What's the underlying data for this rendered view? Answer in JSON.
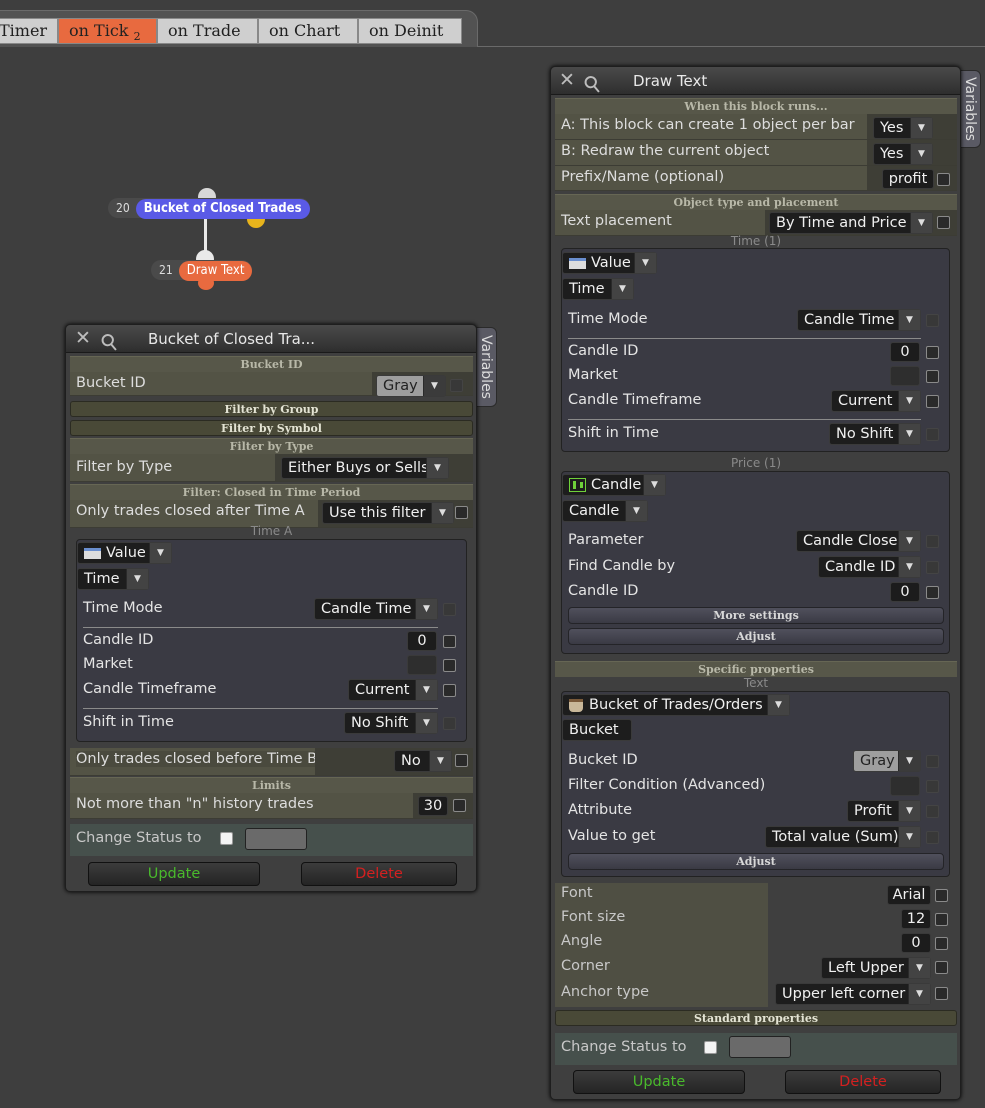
{
  "tabs": [
    {
      "label": "Timer",
      "active": false
    },
    {
      "label": "on Tick",
      "badge": "2",
      "active": true
    },
    {
      "label": "on Trade",
      "active": false
    },
    {
      "label": "on Chart",
      "active": false
    },
    {
      "label": "on Deinit",
      "active": false
    }
  ],
  "nodes": {
    "bucket": {
      "id": "20",
      "label": "Bucket of Closed Trades",
      "color": "#5a5ae6"
    },
    "draw": {
      "id": "21",
      "label": "Draw Text",
      "color": "#e86a3f"
    }
  },
  "left_panel": {
    "title": "Bucket of Closed Tra...",
    "variables_tab": "Variables",
    "bucket_section": "Bucket ID",
    "bucket_label": "Bucket ID",
    "bucket_value": "Gray",
    "filter_group": "Filter by Group",
    "filter_symbol": "Filter by Symbol",
    "filter_type_section": "Filter by Type",
    "filter_type_label": "Filter by Type",
    "filter_type_value": "Either Buys or Sells",
    "closed_section": "Filter: Closed in Time Period",
    "after_label": "Only trades closed after Time A",
    "after_value": "Use this filter",
    "time_a_caption": "Time A",
    "value_label": "Value",
    "time_label": "Time",
    "time_mode_label": "Time Mode",
    "time_mode_value": "Candle Time",
    "candle_id_label": "Candle ID",
    "candle_id_value": "0",
    "market_label": "Market",
    "timeframe_label": "Candle Timeframe",
    "timeframe_value": "Current",
    "shift_label": "Shift in Time",
    "shift_value": "No Shift",
    "before_label": "Only trades closed before Time B",
    "before_value": "No",
    "limits_section": "Limits",
    "limit_label": "Not more than \"n\" history trades",
    "limit_value": "30",
    "status_label": "Change Status to",
    "update": "Update",
    "delete": "Delete"
  },
  "right_panel": {
    "title": "Draw Text",
    "variables_tab": "Variables",
    "runs_section": "When this block runs...",
    "a_label": "A: This block can create 1 object per bar",
    "a_value": "Yes",
    "b_label": "B: Redraw the current object",
    "b_value": "Yes",
    "prefix_label": "Prefix/Name (optional)",
    "prefix_value": "profit",
    "obj_section": "Object type and placement",
    "placement_label": "Text placement",
    "placement_value": "By Time and Price",
    "time1_caption": "Time (1)",
    "value_label": "Value",
    "time_label": "Time",
    "time_mode_label": "Time Mode",
    "time_mode_value": "Candle Time",
    "candle_id_label": "Candle ID",
    "candle_id_value": "0",
    "market_label": "Market",
    "timeframe_label": "Candle Timeframe",
    "timeframe_value": "Current",
    "shift_label": "Shift in Time",
    "shift_value": "No Shift",
    "price1_caption": "Price (1)",
    "candle_label": "Candle",
    "candle_sub": "Candle",
    "parameter_label": "Parameter",
    "parameter_value": "Candle Close",
    "find_label": "Find Candle by",
    "find_value": "Candle ID",
    "candle_id2_label": "Candle ID",
    "candle_id2_value": "0",
    "more_settings": "More settings",
    "adjust": "Adjust",
    "specific_section": "Specific properties",
    "text_caption": "Text",
    "bucket_source": "Bucket of Trades/Orders",
    "bucket_sub": "Bucket",
    "bucket_id_label": "Bucket ID",
    "bucket_id_value": "Gray",
    "filter_cond_label": "Filter Condition (Advanced)",
    "attribute_label": "Attribute",
    "attribute_value": "Profit",
    "value_get_label": "Value to get",
    "value_get_value": "Total value (Sum)",
    "adjust2": "Adjust",
    "font_label": "Font",
    "font_value": "Arial",
    "fontsize_label": "Font size",
    "fontsize_value": "12",
    "angle_label": "Angle",
    "angle_value": "0",
    "corner_label": "Corner",
    "corner_value": "Left Upper",
    "anchor_label": "Anchor type",
    "anchor_value": "Upper left corner",
    "standard_section": "Standard properties",
    "status_label": "Change Status to",
    "update": "Update",
    "delete": "Delete"
  }
}
